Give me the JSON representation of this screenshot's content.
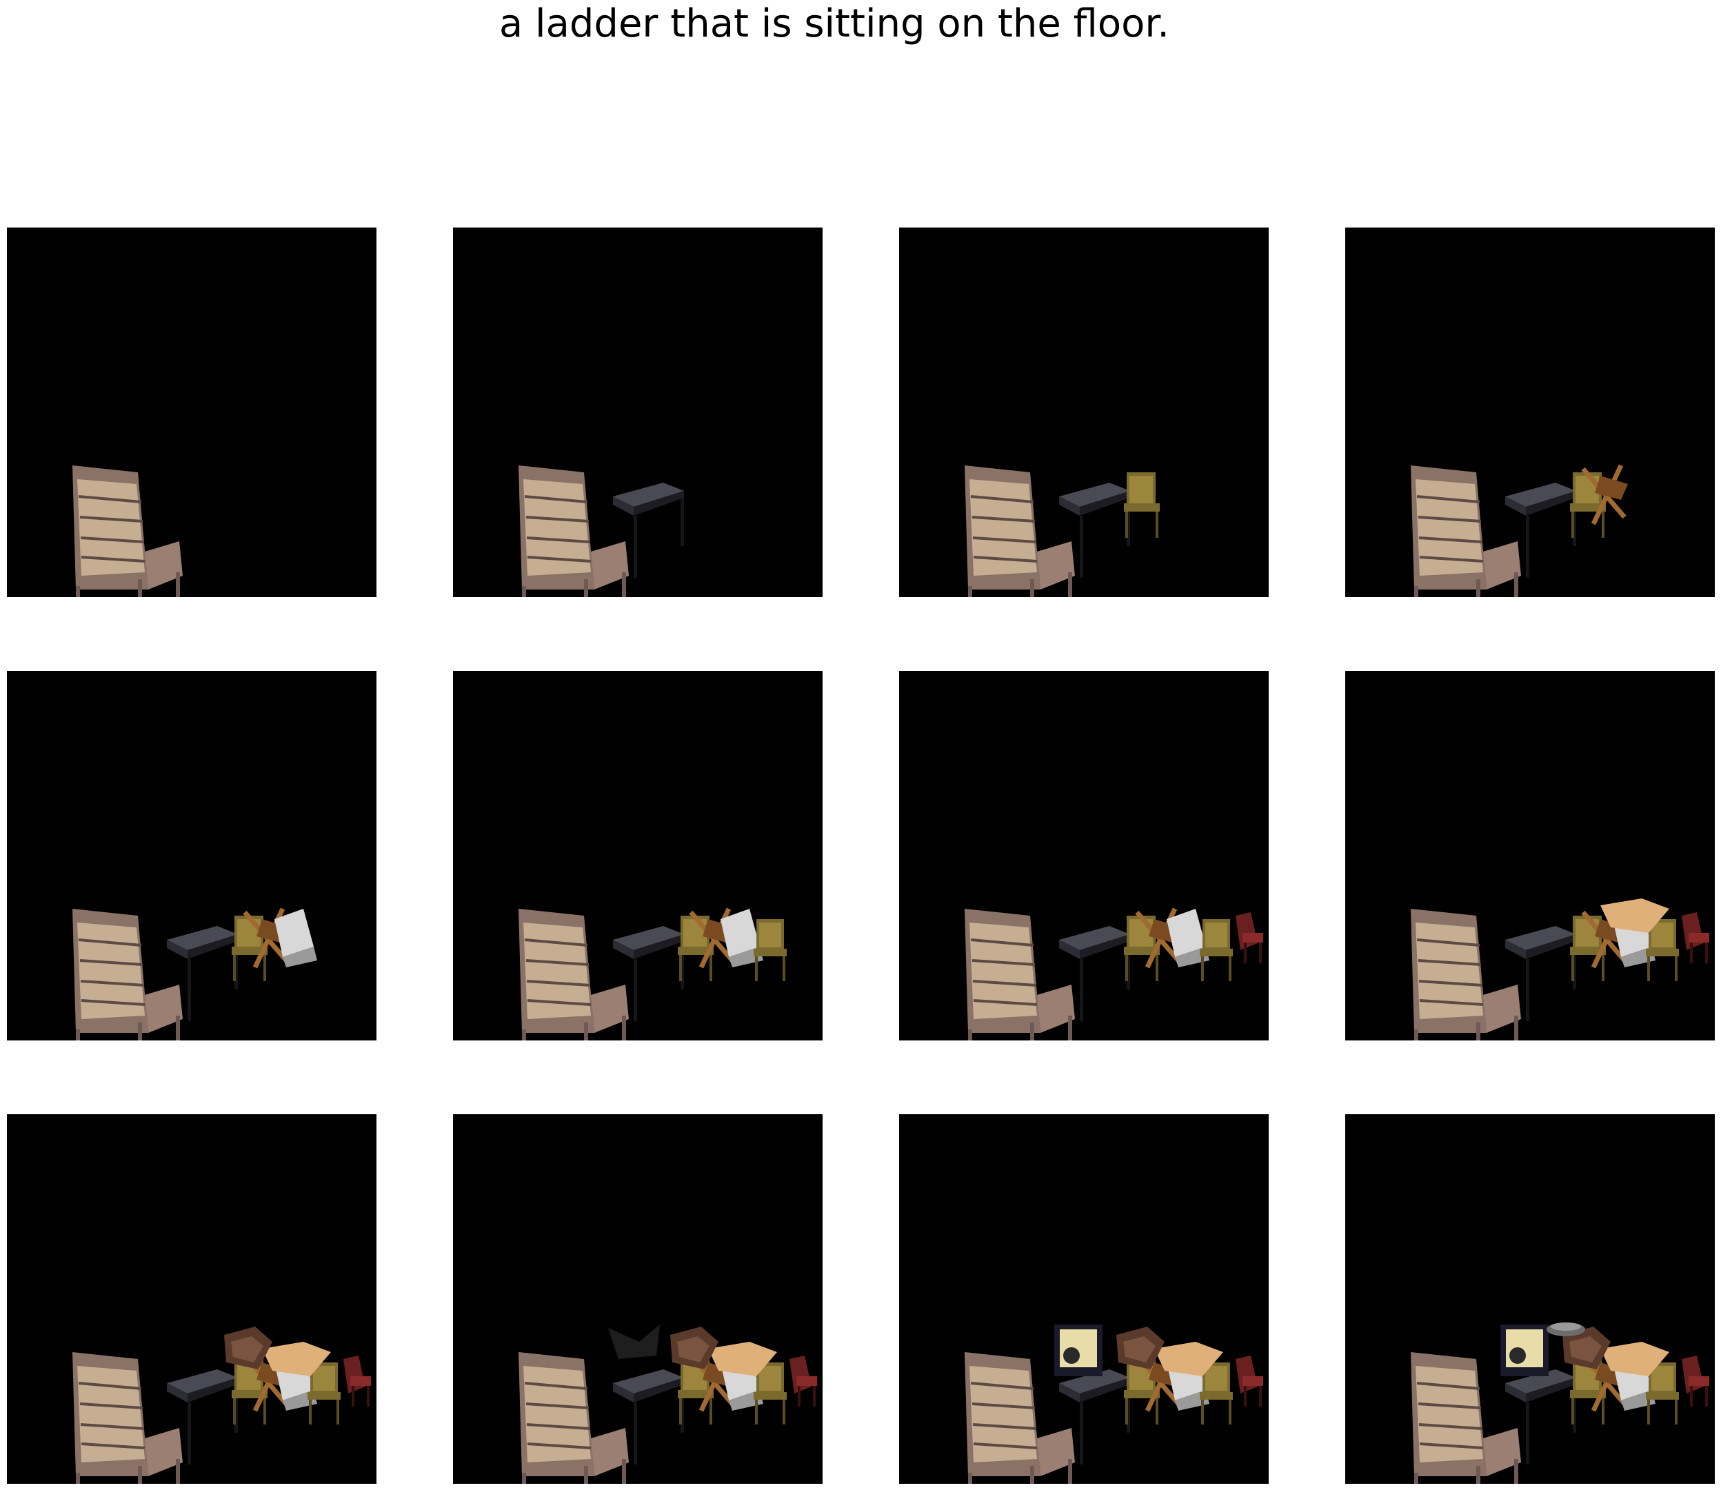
{
  "title": "a ladder that is sitting on the floor.",
  "grid": {
    "rows": 3,
    "columns": 4,
    "panel_background": "#000000",
    "page_background": "#ffffff"
  },
  "panels": [
    {
      "step": 1,
      "objects": [
        "striped-chair"
      ]
    },
    {
      "step": 2,
      "objects": [
        "striped-chair",
        "black-table"
      ]
    },
    {
      "step": 3,
      "objects": [
        "striped-chair",
        "black-table",
        "wicker-chair"
      ]
    },
    {
      "step": 4,
      "objects": [
        "striped-chair",
        "black-table",
        "wicker-chair",
        "folding-chair"
      ]
    },
    {
      "step": 5,
      "objects": [
        "striped-chair",
        "black-table",
        "wicker-chair",
        "folding-chair",
        "white-chair"
      ]
    },
    {
      "step": 6,
      "objects": [
        "striped-chair",
        "black-table",
        "wicker-chair",
        "folding-chair",
        "white-chair",
        "wicker-chair-2"
      ]
    },
    {
      "step": 7,
      "objects": [
        "striped-chair",
        "black-table",
        "wicker-chair",
        "folding-chair",
        "white-chair",
        "wicker-chair-2",
        "red-chair"
      ]
    },
    {
      "step": 8,
      "objects": [
        "striped-chair",
        "black-table",
        "wicker-chair",
        "folding-chair",
        "white-chair",
        "wicker-chair-2",
        "red-chair",
        "tan-blanket"
      ]
    },
    {
      "step": 9,
      "objects": [
        "striped-chair",
        "black-table",
        "wicker-chair",
        "folding-chair",
        "white-chair",
        "wicker-chair-2",
        "red-chair",
        "tan-blanket",
        "brown-cushion"
      ]
    },
    {
      "step": 10,
      "objects": [
        "striped-chair",
        "black-table",
        "wicker-chair",
        "folding-chair",
        "white-chair",
        "wicker-chair-2",
        "red-chair",
        "tan-blanket",
        "brown-cushion",
        "dark-cloth"
      ]
    },
    {
      "step": 11,
      "objects": [
        "striped-chair",
        "black-table",
        "wicker-chair",
        "folding-chair",
        "white-chair",
        "wicker-chair-2",
        "red-chair",
        "tan-blanket",
        "brown-cushion",
        "picture-frame"
      ]
    },
    {
      "step": 12,
      "objects": [
        "striped-chair",
        "black-table",
        "wicker-chair",
        "folding-chair",
        "white-chair",
        "wicker-chair-2",
        "red-chair",
        "tan-blanket",
        "brown-cushion",
        "picture-frame",
        "gray-bowl"
      ]
    }
  ],
  "colors": {
    "striped-chair": "#8a7266",
    "striped-chair-light": "#d9c3a3",
    "black-table": "#1c1c22",
    "wicker": "#7b6a2e",
    "wicker-light": "#b39a4a",
    "folding-chair": "#a06a30",
    "white-chair": "#d8d8d8",
    "red-chair": "#6b2020",
    "tan-blanket": "#e0b07a",
    "brown-cushion": "#5a3a2a",
    "frame": "#e8dca8"
  }
}
